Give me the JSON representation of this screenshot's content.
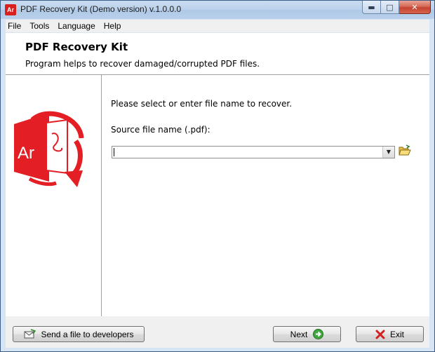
{
  "window": {
    "title": "PDF Recovery Kit (Demo version) v.1.0.0.0",
    "icon_label": "Ar"
  },
  "menu": [
    "File",
    "Tools",
    "Language",
    "Help"
  ],
  "header": {
    "title": "PDF Recovery Kit",
    "subtitle": "Program helps to recover damaged/corrupted PDF files."
  },
  "logo": {
    "text": "Ar",
    "color": "#e31e24"
  },
  "main": {
    "prompt": "Please select or enter file name to recover.",
    "source_label": "Source file name (.pdf):",
    "source_value": ""
  },
  "buttons": {
    "send": "Send a file to developers",
    "next": "Next",
    "exit": "Exit"
  },
  "icons": {
    "dropdown": "chevron-down-icon",
    "browse": "folder-open-icon",
    "send": "envelope-icon",
    "next": "arrow-right-icon",
    "exit": "x-icon"
  }
}
